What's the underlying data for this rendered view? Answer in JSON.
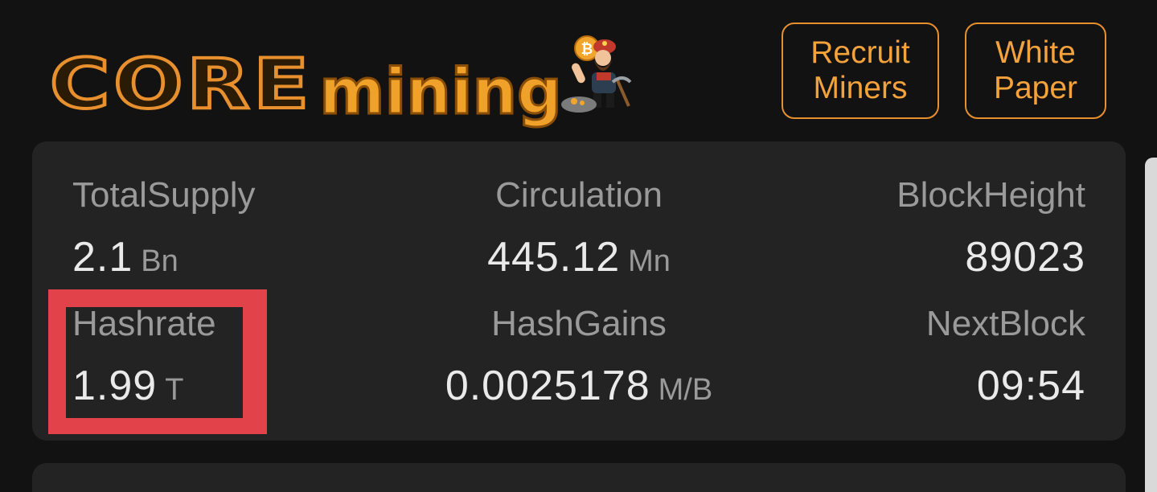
{
  "header": {
    "logo_core": "CORE",
    "logo_mining": "mining",
    "recruit_button": "Recruit\nMiners",
    "whitepaper_button": "White\nPaper"
  },
  "stats": {
    "total_supply": {
      "label": "TotalSupply",
      "value": "2.1",
      "unit": "Bn"
    },
    "circulation": {
      "label": "Circulation",
      "value": "445.12",
      "unit": "Mn"
    },
    "block_height": {
      "label": "BlockHeight",
      "value": "89023",
      "unit": ""
    },
    "hashrate": {
      "label": "Hashrate",
      "value": "1.99",
      "unit": "T"
    },
    "hash_gains": {
      "label": "HashGains",
      "value": "0.0025178",
      "unit": "M/B"
    },
    "next_block": {
      "label": "NextBlock",
      "value": "09:54",
      "unit": ""
    }
  },
  "colors": {
    "accent": "#e8902e",
    "background": "#121212",
    "card": "#232323",
    "highlight": "#e2424a"
  },
  "icons": {
    "mascot": "bitcoin-miner-mascot-icon"
  }
}
